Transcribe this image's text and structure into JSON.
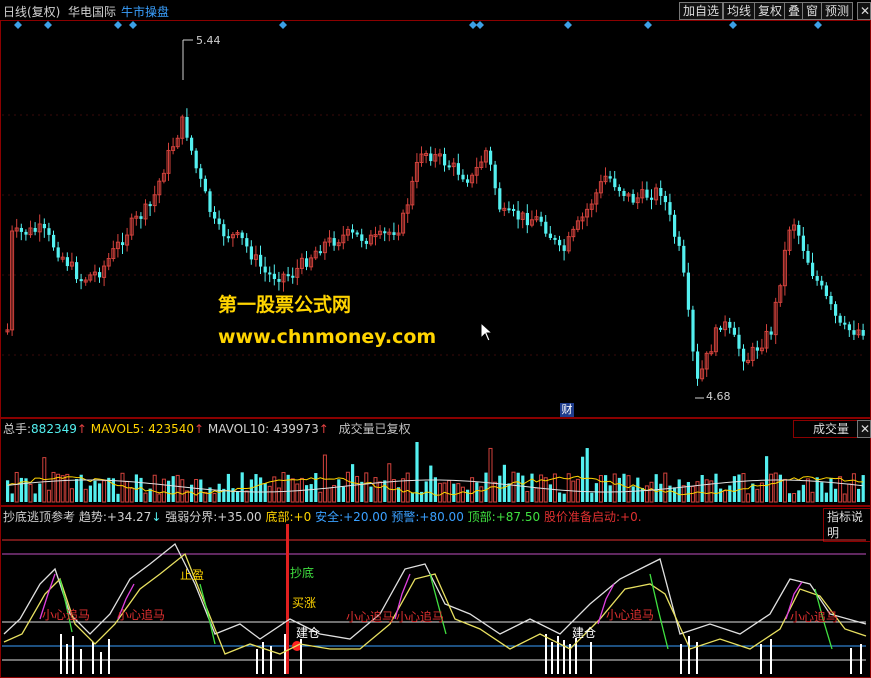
{
  "toolbar": {
    "period": "日线(复权)",
    "stock_name": "华电国际",
    "custom_label": "牛市操盘",
    "buttons": [
      "加自选",
      "均线",
      "复权",
      "叠",
      "窗",
      "预测"
    ]
  },
  "price_panel": {
    "high_label": "5.44",
    "low_label": "4.68",
    "fin_badge": "财",
    "watermark_title": "第一股票公式网",
    "watermark_url": "www.chnmoney.com",
    "colors": {
      "up": "#d2423c",
      "down": "#54f0f0",
      "diamond": "#3ca0e6"
    }
  },
  "volume_panel": {
    "total_label": "总手:",
    "total_value": "882349",
    "ma5_label": "MAVOL5:",
    "ma5_value": "423540",
    "ma10_label": "MAVOL10:",
    "ma10_value": "439973",
    "note": "成交量已复权",
    "button": "成交量"
  },
  "indicator_panel": {
    "name": "抄底逃顶参考",
    "trend_label": "趋势:",
    "trend_value": "+34.27",
    "strength_label": "强弱分界:",
    "strength_value": "+35.00",
    "bottom_label": "底部:",
    "bottom_value": "+0",
    "safe_label": "安全:",
    "safe_value": "+20.00",
    "warn_label": "预警:",
    "warn_value": "+80.00",
    "top_label": "顶部:",
    "top_value": "+87.50",
    "start_label": "股价准备启动:",
    "start_value": "+0.",
    "help_button": "指标说明",
    "annotations": {
      "careful_chase": "小心追马",
      "take_profit": "止盈",
      "buy_bottom": "抄底",
      "buy_rise": "买涨",
      "build_position": "建仓"
    }
  }
}
